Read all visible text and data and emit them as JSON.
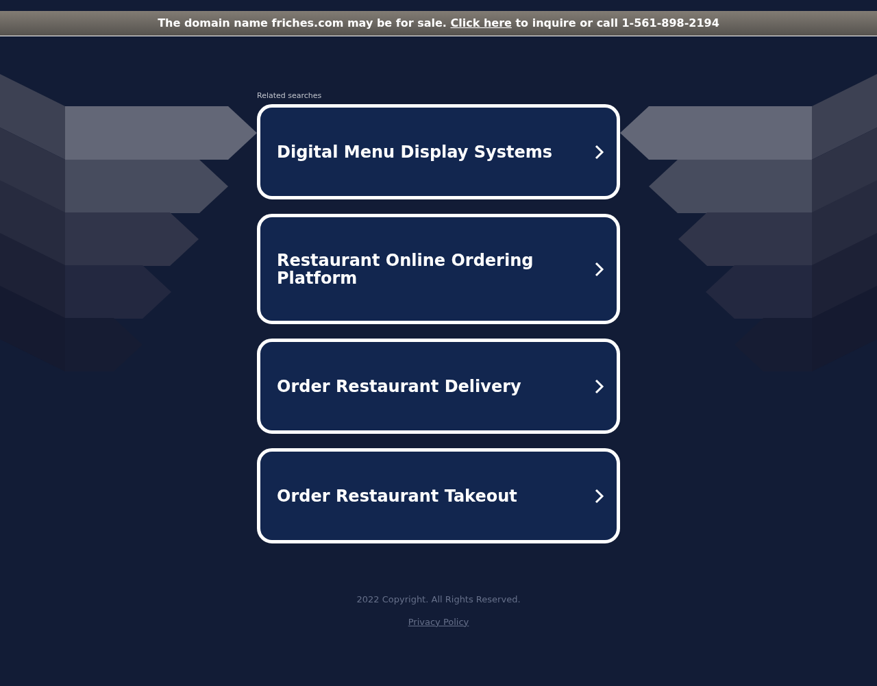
{
  "banner": {
    "before": "The domain name friches.com may be for sale.",
    "link": "Click here",
    "after": "to inquire or call 1-561-898-2194"
  },
  "related": {
    "heading": "Related searches",
    "items": [
      {
        "label": "Digital Menu Display Systems"
      },
      {
        "label": "Restaurant Online Ordering Platform"
      },
      {
        "label": "Order Restaurant Delivery"
      },
      {
        "label": "Order Restaurant Takeout"
      }
    ]
  },
  "footer": {
    "copyright": "2022 Copyright. All Rights Reserved.",
    "privacy": "Privacy Policy"
  }
}
